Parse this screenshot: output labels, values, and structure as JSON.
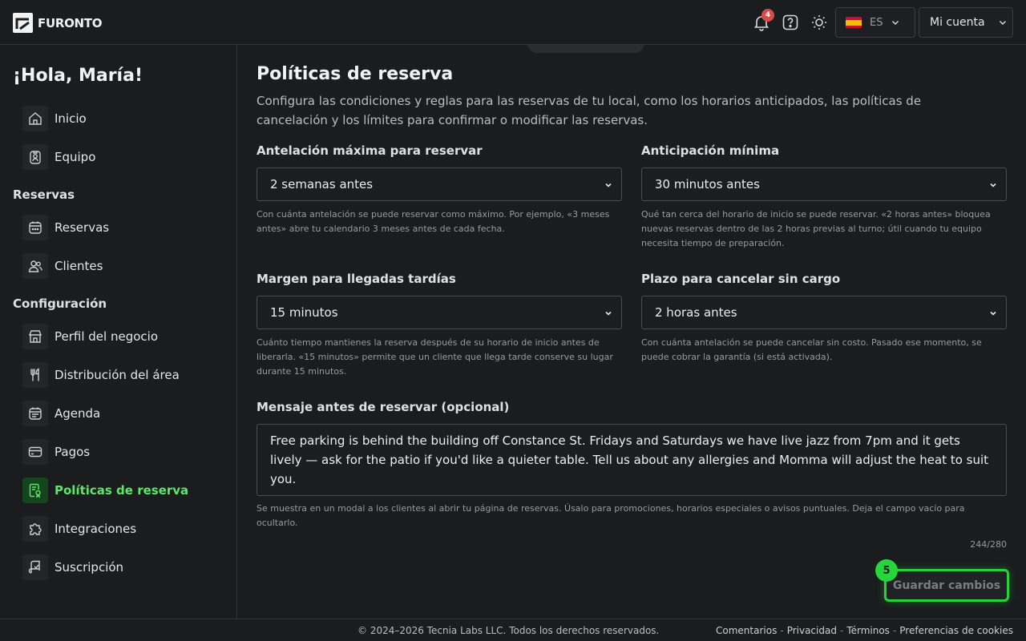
{
  "brand": {
    "name": "FURONTO"
  },
  "header": {
    "notifications_count": "4",
    "language": {
      "code": "ES",
      "flag": "spain-flag-icon"
    },
    "account_label": "Mi cuenta",
    "icons": [
      "bell-icon",
      "help-icon",
      "sun-icon"
    ]
  },
  "sidebar": {
    "greeting": "¡Hola, María!",
    "items_top": [
      {
        "label": "Inicio",
        "icon": "home-icon"
      },
      {
        "label": "Equipo",
        "icon": "badge-icon"
      }
    ],
    "section_reservas": "Reservas",
    "items_reservas": [
      {
        "label": "Reservas",
        "icon": "calendar-icon"
      },
      {
        "label": "Clientes",
        "icon": "users-icon"
      }
    ],
    "section_config": "Configuración",
    "items_config": [
      {
        "label": "Perfil del negocio",
        "icon": "store-icon"
      },
      {
        "label": "Distribución del área",
        "icon": "utensils-icon"
      },
      {
        "label": "Agenda",
        "icon": "schedule-icon"
      },
      {
        "label": "Pagos",
        "icon": "card-icon"
      },
      {
        "label": "Políticas de reserva",
        "icon": "policy-icon",
        "active": true
      },
      {
        "label": "Integraciones",
        "icon": "puzzle-icon"
      },
      {
        "label": "Suscripción",
        "icon": "subscription-icon"
      }
    ]
  },
  "main": {
    "title": "Políticas de reserva",
    "description": "Configura las condiciones y reglas para las reservas de tu local, como los horarios anticipados, las políticas de cancelación y los límites para confirmar o modificar las reservas.",
    "fields": {
      "max_advance": {
        "label": "Antelación máxima para reservar",
        "value": "2 semanas antes",
        "help": "Con cuánta antelación se puede reservar como máximo. Por ejemplo, «3 meses antes» abre tu calendario 3 meses antes de cada fecha."
      },
      "min_advance": {
        "label": "Anticipación mínima",
        "value": "30 minutos antes",
        "help": "Qué tan cerca del horario de inicio se puede reservar. «2 horas antes» bloquea nuevas reservas dentro de las 2 horas previas al turno; útil cuando tu equipo necesita tiempo de preparación."
      },
      "late_margin": {
        "label": "Margen para llegadas tardías",
        "value": "15 minutos",
        "help": "Cuánto tiempo mantienes la reserva después de su horario de inicio antes de liberarla. «15 minutos» permite que un cliente que llega tarde conserve su lugar durante 15 minutos."
      },
      "cancel_window": {
        "label": "Plazo para cancelar sin cargo",
        "value": "2 horas antes",
        "help": "Con cuánta antelación se puede cancelar sin costo. Pasado ese momento, se puede cobrar la garantía (si está activada)."
      },
      "message": {
        "label": "Mensaje antes de reservar (opcional)",
        "value": "Free parking is behind the building off Constance St. Fridays and Saturdays we have live jazz from 7pm and it gets lively — ask for the patio if you'd like a quieter table. Tell us about any allergies and Momma will adjust the heat to suit you.",
        "help": "Se muestra en un modal a los clientes al abrir tu página de reservas. Úsalo para promociones, horarios especiales o avisos puntuales. Deja el campo vacío para ocultarlo.",
        "counter": "244/280"
      }
    },
    "save_label": "Guardar cambios",
    "step_badge": "5"
  },
  "footer": {
    "copyright": "© 2024–2026 Tecnia Labs LLC. Todos los derechos reservados.",
    "links": [
      "Comentarios",
      "Privacidad",
      "Términos",
      "Preferencias de cookies"
    ],
    "separator": "-"
  },
  "colors": {
    "accent": "#27d13b",
    "active_text": "#5ee66b",
    "badge": "#d94a4a"
  }
}
